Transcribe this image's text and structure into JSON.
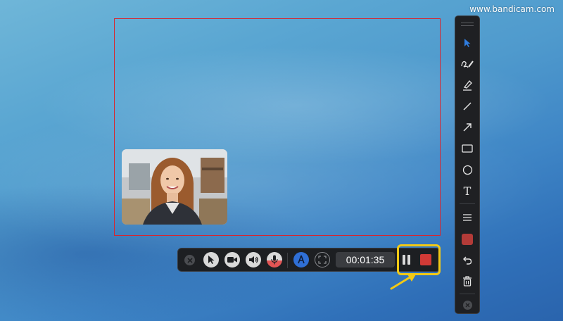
{
  "watermark": {
    "text": "www.bandicam.com"
  },
  "recording_bar": {
    "timer": "00:01:35",
    "buttons": [
      {
        "name": "close-icon"
      },
      {
        "name": "cursor-icon"
      },
      {
        "name": "webcam-icon"
      },
      {
        "name": "speaker-icon"
      },
      {
        "name": "microphone-icon"
      },
      {
        "name": "pen-draw-icon"
      },
      {
        "name": "fullscreen-target-icon"
      },
      {
        "name": "pause-icon"
      },
      {
        "name": "stop-icon"
      }
    ],
    "stop_color": "#d13a36",
    "highlight_color": "#f2c915"
  },
  "capture_area": {
    "border_color": "#d7262f"
  },
  "drawing_toolbar": {
    "tools": [
      {
        "name": "select-arrow-icon"
      },
      {
        "name": "freehand-pen-icon"
      },
      {
        "name": "highlighter-icon"
      },
      {
        "name": "line-icon"
      },
      {
        "name": "arrow-icon"
      },
      {
        "name": "rectangle-icon"
      },
      {
        "name": "ellipse-icon"
      },
      {
        "name": "text-icon"
      },
      {
        "name": "line-width-icon"
      },
      {
        "name": "color-swatch"
      },
      {
        "name": "undo-icon"
      },
      {
        "name": "trash-icon"
      },
      {
        "name": "close-icon"
      }
    ],
    "text_tool_glyph": "T",
    "selected_color": "#b33b38",
    "active_tool_color": "#2f7de0"
  }
}
